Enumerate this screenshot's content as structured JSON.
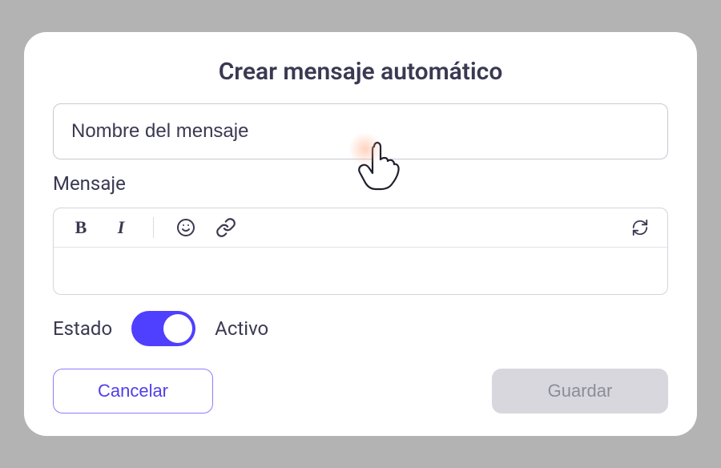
{
  "title": "Crear mensaje automático",
  "name_input": {
    "placeholder": "Nombre del mensaje",
    "value": ""
  },
  "message": {
    "label": "Mensaje",
    "value": ""
  },
  "toolbar": {
    "bold_icon": "B",
    "italic_icon": "I",
    "emoji_icon": "emoji-icon",
    "link_icon": "link-icon",
    "refresh_icon": "refresh-icon"
  },
  "status": {
    "label": "Estado",
    "value_label": "Activo",
    "active": true
  },
  "actions": {
    "cancel": "Cancelar",
    "save": "Guardar"
  },
  "colors": {
    "accent": "#4f3fff",
    "text": "#3a3952",
    "save_disabled_bg": "#d7d7dd"
  }
}
